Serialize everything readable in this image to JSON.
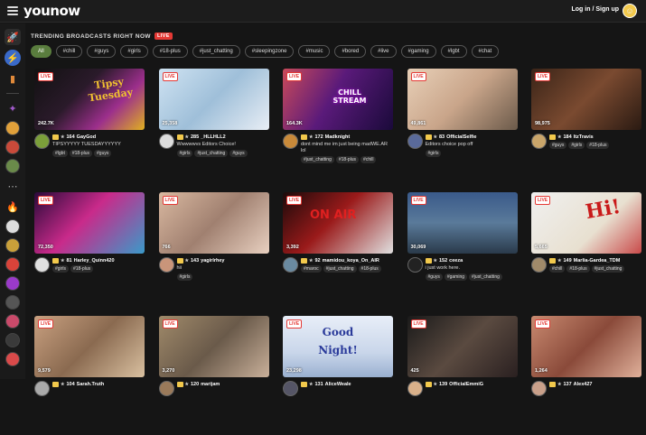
{
  "header": {
    "logo": "younow",
    "login_label": "Log in / Sign up"
  },
  "section": {
    "title": "TRENDING BROADCASTS RIGHT NOW",
    "live_label": "LIVE"
  },
  "chips": [
    "All",
    "#chill",
    "#guys",
    "#girls",
    "#18-plus",
    "#just_chatting",
    "#sleepingzone",
    "#music",
    "#bored",
    "#live",
    "#gaming",
    "#lgbt",
    "#chat"
  ],
  "live_badge": "LIVE",
  "cards": [
    {
      "viewers": "242.7K",
      "level": "164",
      "name": "GayGod",
      "desc": "TIPSYYYYY TUESDAYYYYYY",
      "tags": [
        "#lgbt",
        "#18-plus",
        "#guys"
      ],
      "overlay": "Tipsy Tuesday",
      "bg": "linear-gradient(135deg,#111 0%,#2a1a2a 40%,#9c2f8c 70%,#e0b020 100%)",
      "av": "#7b9f3a"
    },
    {
      "viewers": "25,358",
      "level": "285",
      "name": "_HLLHLL2",
      "desc": "Wwwwwvs Editors Choice!",
      "tags": [
        "#girls",
        "#just_chatting",
        "#guys"
      ],
      "overlay": "",
      "bg": "linear-gradient(135deg,#cfe3f2 0%,#9fbfd9 50%,#e8eef5 100%)",
      "av": "#ddd"
    },
    {
      "viewers": "164.3K",
      "level": "172",
      "name": "Madknight",
      "desc": "dont mind me im just being madWE.AR lol",
      "tags": [
        "#just_chatting",
        "#18-plus",
        "#chill"
      ],
      "overlay": "CHILL STREAM",
      "bg": "linear-gradient(120deg,#c94a5a 0%,#5a1a7a 45%,#1a0a3a 100%)",
      "av": "#c98a3a"
    },
    {
      "viewers": "49,861",
      "level": "83",
      "name": "OfficialSelfie",
      "desc": "Editors choice pop off",
      "tags": [
        "#girls"
      ],
      "overlay": "",
      "bg": "linear-gradient(135deg,#e8d0b8 0%,#c9a58a 50%,#6b5a4a 100%)",
      "av": "#5a6a9a"
    },
    {
      "viewers": "98,975",
      "level": "184",
      "name": "ItzTravis",
      "desc": "",
      "tags": [
        "#guys",
        "#girls",
        "#18-plus"
      ],
      "overlay": "",
      "bg": "linear-gradient(135deg,#3a2418 0%,#7a4a30 50%,#2a1a12 100%)",
      "av": "#c9a56a"
    },
    {
      "viewers": "72,350",
      "level": "81",
      "name": "Harley_Quinn420",
      "desc": "",
      "tags": [
        "#girls",
        "#18-plus"
      ],
      "overlay": "",
      "bg": "linear-gradient(135deg,#2a0a3a 0%,#c92a8a 45%,#3a9ac9 100%)",
      "av": "#e0e0e0"
    },
    {
      "viewers": "766",
      "level": "143",
      "name": "yagirlrhey",
      "desc": "hii",
      "tags": [
        "#girls"
      ],
      "overlay": "",
      "bg": "linear-gradient(135deg,#d9b8a0 0%,#a08070 50%,#e8d0c0 100%)",
      "av": "#c9957a"
    },
    {
      "viewers": "3,392",
      "level": "92",
      "name": "mamidou_koya_On_AIR",
      "desc": "",
      "tags": [
        "#maroc",
        "#just_chatting",
        "#18-plus"
      ],
      "overlay": "ON AIR",
      "bg": "linear-gradient(135deg,#1a0a0a 0%,#9a1a1a 45%,#e0e0e0 100%)",
      "av": "#6a8aa0"
    },
    {
      "viewers": "30,069",
      "level": "152",
      "name": "ceeza",
      "desc": "i just work here.",
      "tags": [
        "#guys",
        "#gaming",
        "#just_chatting"
      ],
      "overlay": "",
      "bg": "linear-gradient(180deg,#3a5a8a 0%,#5a7a9a 50%,#2a3a4a 100%)",
      "av": "#222"
    },
    {
      "viewers": "5,665",
      "level": "149",
      "name": "Marlia-Gardea_TDM",
      "desc": "",
      "tags": [
        "#chill",
        "#18-plus",
        "#just_chatting"
      ],
      "overlay": "Hi!",
      "bg": "linear-gradient(135deg,#f0f0f0 0%,#e8e0d0 60%,#c94a4a 100%)",
      "av": "#a08a6a"
    },
    {
      "viewers": "9,579",
      "level": "104",
      "name": "Sarah.Truth",
      "desc": "",
      "tags": [],
      "overlay": "",
      "bg": "linear-gradient(135deg,#c9a080 0%,#8a6a50 50%,#d9c0a0 100%)",
      "av": "#aaa"
    },
    {
      "viewers": "3,270",
      "level": "120",
      "name": "marijam",
      "desc": "",
      "tags": [],
      "overlay": "",
      "bg": "linear-gradient(135deg,#a08a6a 0%,#6a5a4a 50%,#c9b09a 100%)",
      "av": "#9a7a5a"
    },
    {
      "viewers": "23,298",
      "level": "131",
      "name": "AliceWeale",
      "desc": "",
      "tags": [],
      "overlay": "Good Night!",
      "bg": "linear-gradient(180deg,#e8eef8 0%,#c9d6ea 60%,#9ab0d0 100%)",
      "av": "#556"
    },
    {
      "viewers": "425",
      "level": "139",
      "name": "OfficialEmmiG",
      "desc": "",
      "tags": [],
      "overlay": "",
      "bg": "linear-gradient(135deg,#1a1a1a 0%,#5a4a40 50%,#2a2020 100%)",
      "av": "#d9b08a"
    },
    {
      "viewers": "1,264",
      "level": "137",
      "name": "Alex427",
      "desc": "",
      "tags": [],
      "overlay": "",
      "bg": "linear-gradient(135deg,#c98a70 0%,#8a4a3a 50%,#e0b09a 100%)",
      "av": "#c9a08a"
    }
  ]
}
